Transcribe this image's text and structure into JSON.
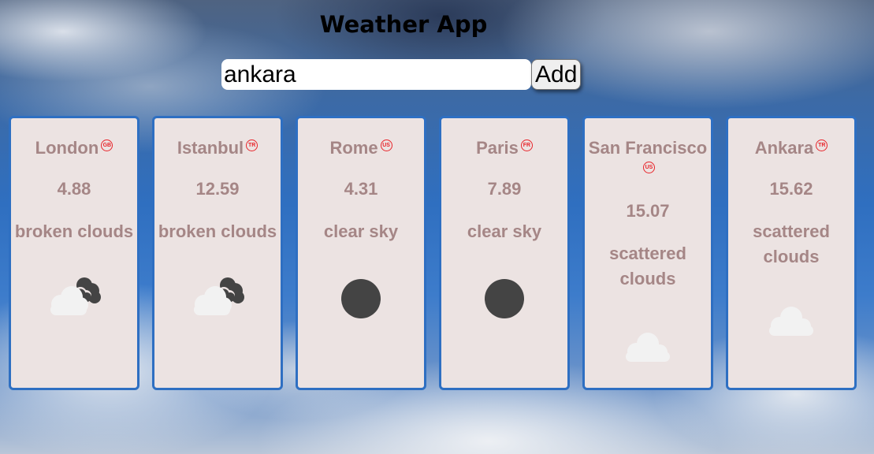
{
  "app": {
    "title": "Weather App"
  },
  "search": {
    "value": "ankara",
    "add_label": "Add"
  },
  "cards": [
    {
      "city": "London",
      "country": "GB",
      "temp": "4.88",
      "description": "broken clouds",
      "icon": "broken-clouds-night-icon"
    },
    {
      "city": "Istanbul",
      "country": "TR",
      "temp": "12.59",
      "description": "broken clouds",
      "icon": "broken-clouds-night-icon"
    },
    {
      "city": "Rome",
      "country": "US",
      "temp": "4.31",
      "description": "clear sky",
      "icon": "clear-sky-night-icon"
    },
    {
      "city": "Paris",
      "country": "FR",
      "temp": "7.89",
      "description": "clear sky",
      "icon": "clear-sky-night-icon"
    },
    {
      "city": "San Francisco",
      "country": "US",
      "temp": "15.07",
      "description": "scattered clouds",
      "icon": "scattered-clouds-icon"
    },
    {
      "city": "Ankara",
      "country": "TR",
      "temp": "15.62",
      "description": "scattered clouds",
      "icon": "scattered-clouds-icon"
    }
  ],
  "colors": {
    "card_border": "#2e6fc2",
    "card_background": "#ece3e2",
    "card_text": "#a58686",
    "badge": "#e8242a"
  }
}
